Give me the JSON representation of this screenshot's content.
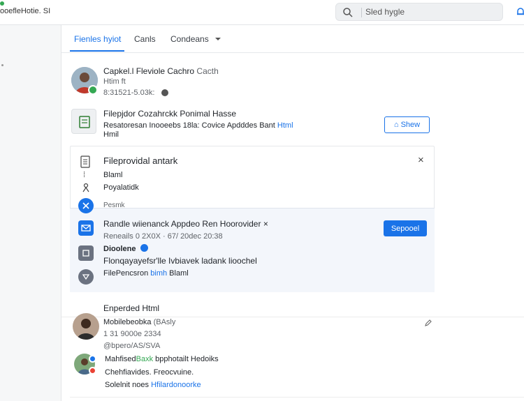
{
  "header": {
    "app_title": "ooefleHotie. SI",
    "search_placeholder": "Sled hygle"
  },
  "tabs": [
    {
      "label": "Fienles hyiot",
      "active": true
    },
    {
      "label": "Canls",
      "active": false
    },
    {
      "label": "Condeans",
      "active": false
    }
  ],
  "profile": {
    "name": "Capkel.l Fleviole Cachro",
    "name_suffix": "Cacth",
    "subtitle": "Htim ft",
    "meta": "8:31521-5.03k:"
  },
  "file_row": {
    "title": "Filepjdor Cozahrckk Ponimal Hasse",
    "desc": "Resatoresan Inooeebs 18la: Covice Apdddes Bant",
    "desc_link": "Html",
    "desc2": "Hmil",
    "button": "Shew"
  },
  "card": {
    "title": "Fileprovidal antark",
    "item1": "Blaml",
    "item2": "Poyalatidk",
    "item3": "Pesmk",
    "sub_title": "Randle wiienanck Appdeo Ren Hoorovider",
    "sub_close": "×",
    "sub_line": "Reneails 0 2X0X · 67/ 20dec 20:38",
    "sub_name": "Dioolene",
    "sub_desc": "Flonqayayefsr'lle Ivbiavek ladank lioochel",
    "sub_file": "FilePencsron",
    "sub_file_link": "bimh",
    "sub_file_end": "Blaml",
    "button": "Sepooel"
  },
  "expanded": {
    "heading": "Enperded Html",
    "person1": {
      "name": "Mobilebeobka",
      "name_suffix": "(BAsly",
      "phone": "1 31 9000e 2334",
      "handle": "@bpero/AS/SVA"
    },
    "person2": {
      "line1_a": "Mahfised",
      "line1_link": "Baxk",
      "line1_b": "bpphotailt Hedoiks",
      "line2": "Chehfiavides. Freocvuine.",
      "line3_a": "Solelnit noes",
      "line3_link": "Hfilardonoorke"
    }
  },
  "colors": {
    "accent": "#1a73e8",
    "badge_green": "#34a853",
    "badge_red": "#ea4335"
  }
}
